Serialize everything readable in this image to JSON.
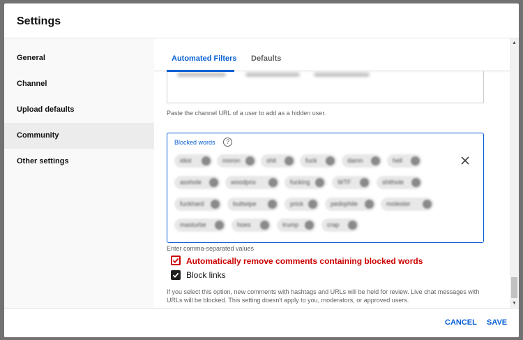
{
  "dialog": {
    "title": "Settings"
  },
  "sidebar": {
    "items": [
      {
        "label": "General"
      },
      {
        "label": "Channel"
      },
      {
        "label": "Upload defaults"
      },
      {
        "label": "Community"
      },
      {
        "label": "Other settings"
      }
    ],
    "active": "Community"
  },
  "tabs": [
    {
      "label": "Automated Filters",
      "active": true
    },
    {
      "label": "Defaults",
      "active": false
    }
  ],
  "hidden_users": {
    "hint": "Paste the channel URL of a user to add as a hidden user."
  },
  "blocked_words": {
    "label": "Blocked words",
    "hint": "Enter comma-separated values",
    "words": [
      "idiot",
      "moron",
      "shit",
      "fuck",
      "damn",
      "hell",
      "asshole",
      "woodprix",
      "fucking",
      "WTF",
      "shithole",
      "fuckhard",
      "buttwipe",
      "prick",
      "pedophile",
      "molester",
      "masturbe",
      "hoes",
      "trump",
      "crap"
    ]
  },
  "options": {
    "auto_remove": {
      "label": "Automatically remove comments containing blocked words",
      "checked": true
    },
    "block_links": {
      "label": "Block links",
      "checked": true
    },
    "note": "If you select this option, new comments with hashtags and URLs will be held for review. Live chat messages with URLs will be blocked. This setting doesn't apply to you, moderators, or approved users."
  },
  "footer": {
    "cancel_label": "CANCEL",
    "save_label": "SAVE"
  },
  "colors": {
    "accent": "#065fd4",
    "alert": "#cc0000"
  },
  "icons": {
    "help": "help-circle-icon",
    "clear": "close-icon",
    "check": "check-icon"
  }
}
